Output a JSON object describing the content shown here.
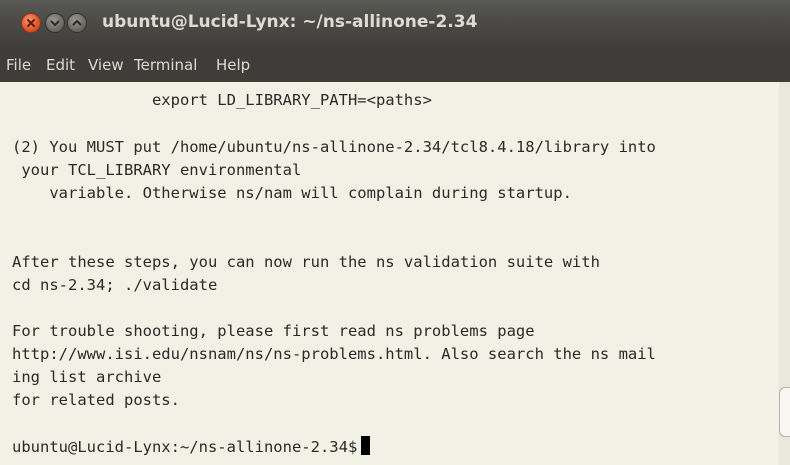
{
  "window": {
    "title": "ubuntu@Lucid-Lynx: ~/ns-allinone-2.34"
  },
  "menu": [
    "File",
    "Edit",
    "View",
    "Terminal",
    "Help"
  ],
  "terminal": {
    "lines": [
      "               export LD_LIBRARY_PATH=<paths>",
      "",
      "(2) You MUST put /home/ubuntu/ns-allinone-2.34/tcl8.4.18/library into",
      " your TCL_LIBRARY environmental",
      "    variable. Otherwise ns/nam will complain during startup.",
      "",
      "",
      "After these steps, you can now run the ns validation suite with",
      "cd ns-2.34; ./validate",
      "",
      "For trouble shooting, please first read ns problems page",
      "http://www.isi.edu/nsnam/ns/ns-problems.html. Also search the ns mail",
      "ing list archive",
      "for related posts.",
      ""
    ],
    "prompt": "ubuntu@Lucid-Lynx:~/ns-allinone-2.34$"
  },
  "icons": [
    "close-icon",
    "minimize-icon",
    "maximize-icon",
    "cursor"
  ],
  "colors": {
    "title_bar": "#4b4a46",
    "menu_bar": "#3e3d39",
    "terminal_bg": "#f2f1e6",
    "terminal_fg": "#2b2a27",
    "close_button": "#e2582d"
  }
}
